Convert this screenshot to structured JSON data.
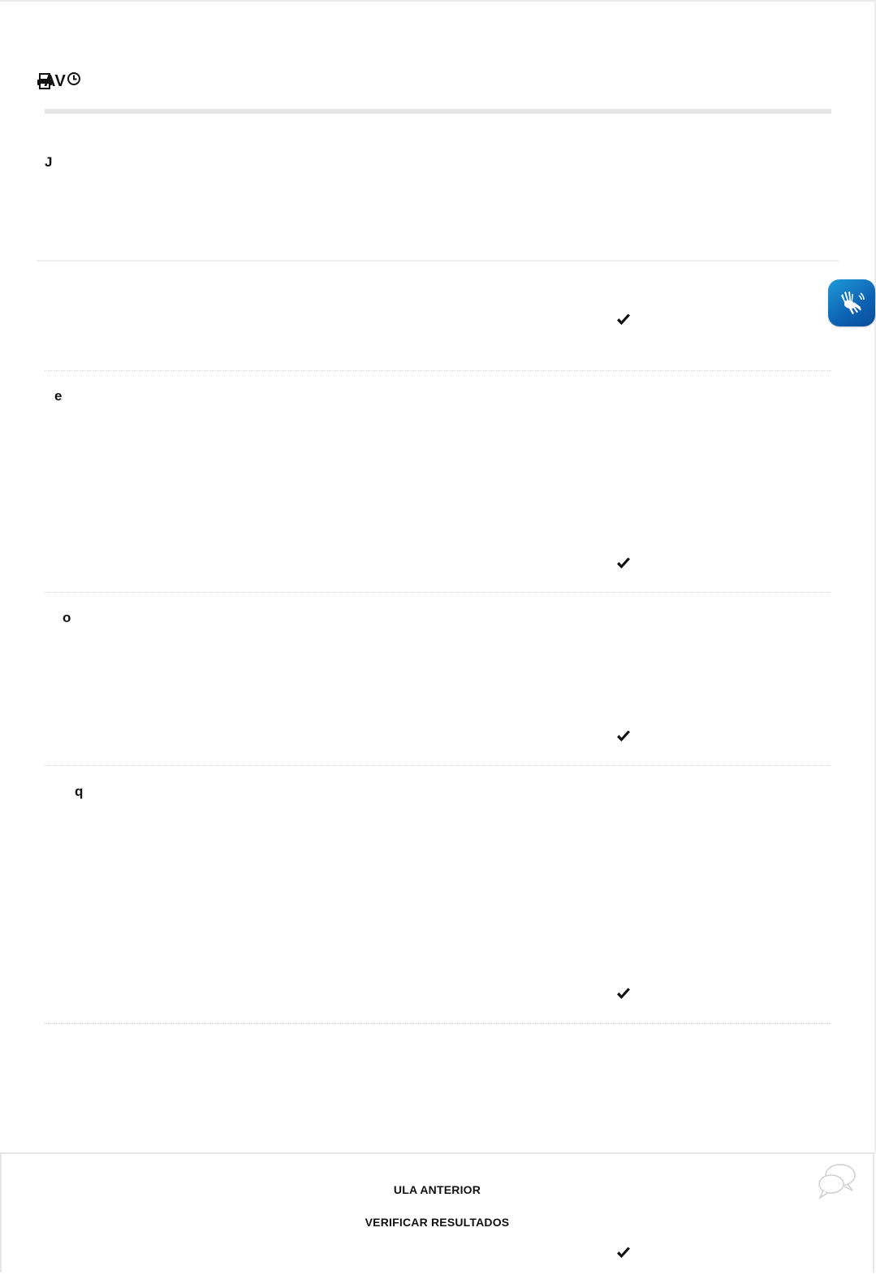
{
  "header": {
    "title": "AV",
    "print_icon": "print-icon",
    "history_icon": "clock-icon"
  },
  "sections": [
    {
      "label": "J"
    },
    {
      "label": "e"
    },
    {
      "label": "o"
    },
    {
      "label": "q"
    }
  ],
  "accessibility": {
    "libras_icon": "sign-language-hands-icon",
    "libras_color": "#1673c4"
  },
  "footer": {
    "previous_label": "ULA ANTERIOR",
    "verify_label": "VERIFICAR RESULTADOS",
    "chat_icon": "chat-bubbles-icon"
  }
}
